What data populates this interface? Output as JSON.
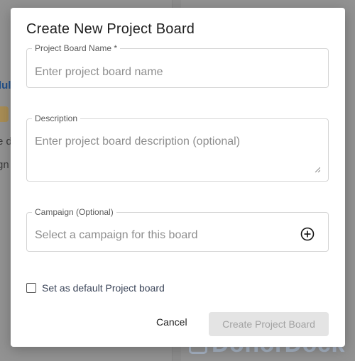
{
  "background": {
    "left_snippets": [
      "lul",
      "e d",
      "gn"
    ],
    "watermark": "DonorDock"
  },
  "modal": {
    "title": "Create New Project Board",
    "name_field": {
      "label": "Project Board Name *",
      "placeholder": "Enter project board name"
    },
    "description_field": {
      "label": "Description",
      "placeholder": "Enter project board description (optional)"
    },
    "campaign_field": {
      "label": "Campaign (Optional)",
      "placeholder": "Select a campaign for this board"
    },
    "default_checkbox": {
      "label": "Set as default Project board",
      "checked": false
    },
    "cancel_label": "Cancel",
    "create_label": "Create Project Board"
  },
  "colors": {
    "overlay": "#8d8d8d",
    "modal_bg": "#ffffff",
    "disabled_button_bg": "#e4e4e4",
    "disabled_button_text": "#a2a2a2",
    "watermark": "#a7b3c4"
  },
  "icons": {
    "add_campaign": "plus-circle-icon",
    "textarea_resize": "resize-handle-icon"
  }
}
